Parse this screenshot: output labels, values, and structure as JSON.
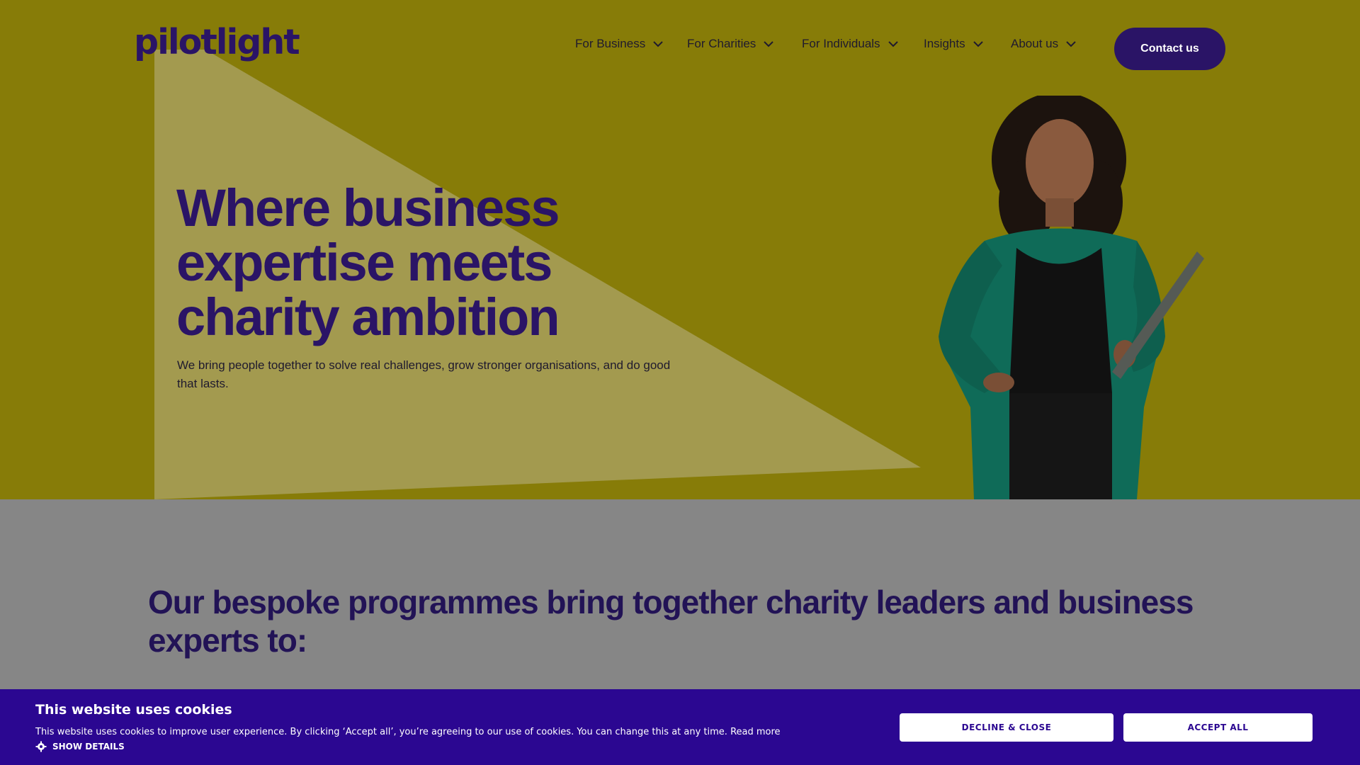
{
  "brand": {
    "logo_text": "pilotlight"
  },
  "nav": {
    "items": [
      {
        "label": "For Business"
      },
      {
        "label": "For Charities"
      },
      {
        "label": "For Individuals"
      },
      {
        "label": "Insights"
      },
      {
        "label": "About us"
      }
    ],
    "contact_label": "Contact us"
  },
  "hero": {
    "title_lines": [
      "Where business",
      "expertise meets",
      "charity ambition"
    ],
    "subtitle": "We bring people together to solve real challenges, grow stronger organisations, and do good that lasts."
  },
  "programmes": {
    "title": "Our bespoke programmes bring together charity leaders and business experts to:"
  },
  "cookie": {
    "title": "This website uses cookies",
    "text": "This website uses cookies to improve user experience. By clicking ‘Accept all’, you’re agreeing to our use of cookies. You can change this at any time.",
    "read_more": "Read more",
    "show_details": "SHOW DETAILS",
    "decline_label": "DECLINE & CLOSE",
    "accept_label": "ACCEPT ALL"
  },
  "colors": {
    "hero_bg": "#877c08",
    "brand_navy": "#2a1466",
    "cookie_bg": "#2b0791",
    "section_bg": "#868686"
  },
  "icons": {
    "nav_chevron": "chevron-down-icon",
    "cookie_settings": "gear-icon"
  }
}
